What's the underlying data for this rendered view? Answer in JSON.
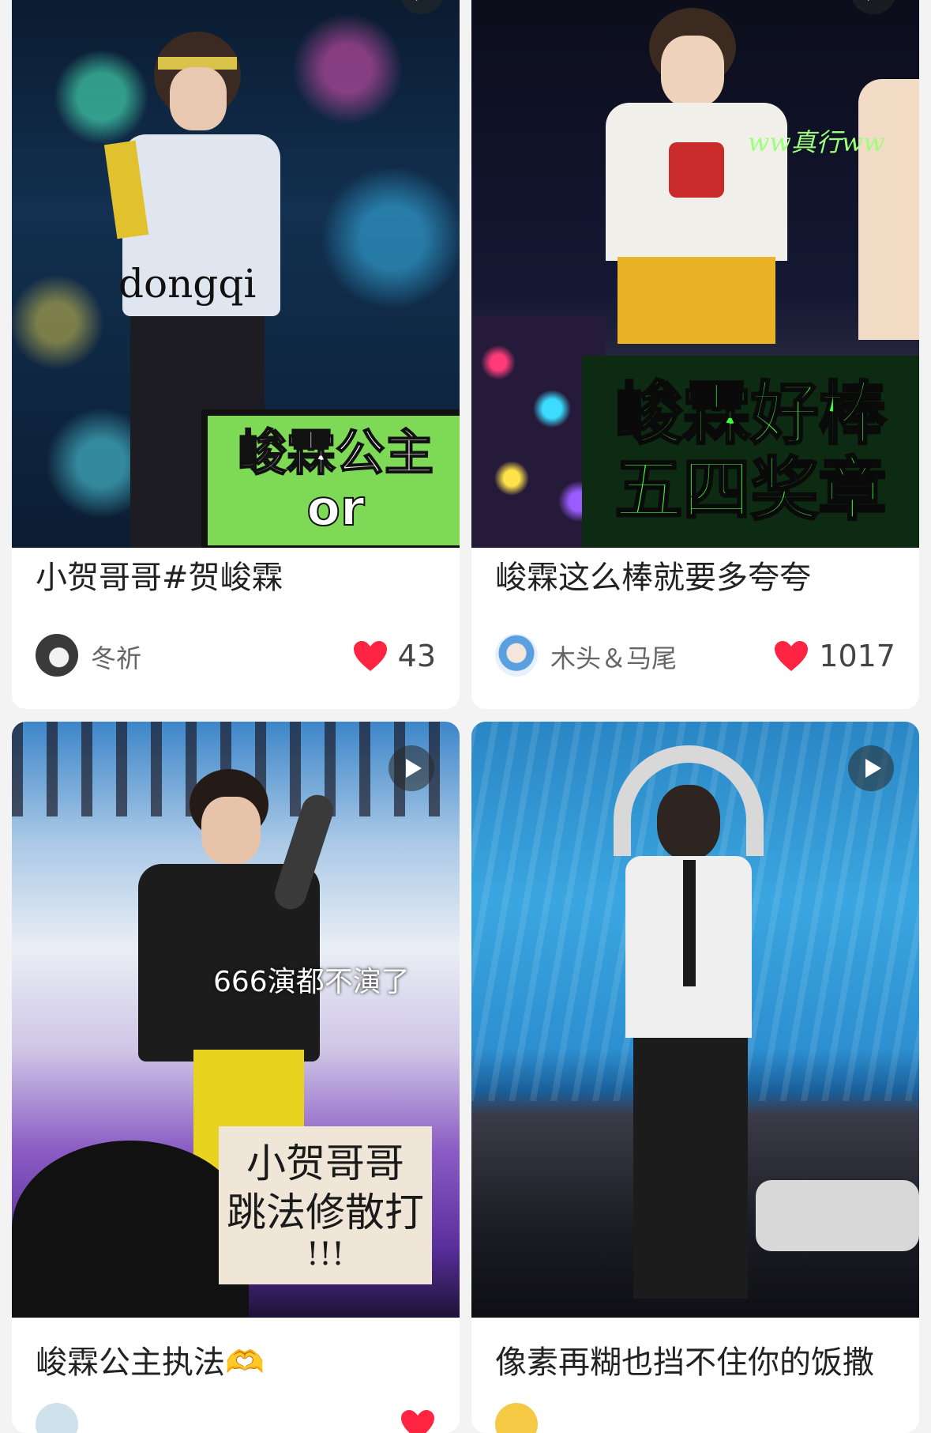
{
  "colors": {
    "background": "#f3f3f3",
    "card": "#ffffff",
    "heart": "#ff2442",
    "title_text": "#222222",
    "meta_text": "#666666"
  },
  "feed": [
    {
      "title": "小贺哥哥#贺峻霖",
      "author": "冬祈",
      "likes": "43",
      "has_video": true,
      "image_texts": {
        "watermark": "dongqi",
        "sign_line1": "峻霖公主",
        "sign_line2": "or"
      }
    },
    {
      "title": "峻霖这么棒就要多夸夸",
      "author": "木头＆马尾",
      "likes": "1017",
      "has_video": true,
      "image_texts": {
        "watermark": "ww真行ww",
        "sign_line1": "峻霖好棒",
        "sign_line2": "五四奖章"
      }
    },
    {
      "title": "峻霖公主执法🫶",
      "author": "",
      "likes": "",
      "has_video": true,
      "image_texts": {
        "caption": "666演都不演了",
        "sign_line1": "小贺哥哥",
        "sign_line2": "跳法修散打",
        "sign_line3": "!!!"
      }
    },
    {
      "title": "像素再糊也挡不住你的饭撒",
      "author": "",
      "likes": "",
      "has_video": true,
      "image_texts": {}
    }
  ],
  "icons": {
    "play": "play-icon",
    "heart": "heart-icon",
    "avatar": "user-avatar"
  }
}
